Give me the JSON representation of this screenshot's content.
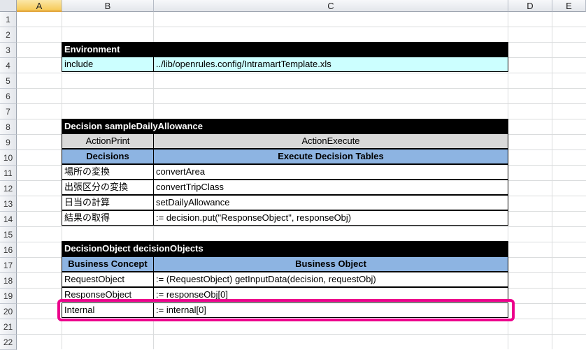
{
  "columns": [
    "A",
    "B",
    "C",
    "D",
    "E"
  ],
  "rows": [
    "1",
    "2",
    "3",
    "4",
    "5",
    "6",
    "7",
    "8",
    "9",
    "10",
    "11",
    "12",
    "13",
    "14",
    "15",
    "16",
    "17",
    "18",
    "19",
    "20",
    "21",
    "22"
  ],
  "environment": {
    "title": "Environment",
    "key": "include",
    "value": "../lib/openrules.config/IntramartTemplate.xls"
  },
  "decision": {
    "title": "Decision sampleDailyAllowance",
    "header_b": "ActionPrint",
    "header_c": "ActionExecute",
    "sub_b": "Decisions",
    "sub_c": "Execute Decision Tables",
    "rows": [
      {
        "b": "場所の変換",
        "c": "convertArea"
      },
      {
        "b": "出張区分の変換",
        "c": "convertTripClass"
      },
      {
        "b": "日当の計算",
        "c": "setDailyAllowance"
      },
      {
        "b": "結果の取得",
        "c": ":= decision.put(\"ResponseObject\", responseObj)"
      }
    ]
  },
  "decision_objects": {
    "title": "DecisionObject decisionObjects",
    "header_b": "Business Concept",
    "header_c": "Business Object",
    "rows": [
      {
        "b": "RequestObject",
        "c": ":=  (RequestObject) getInputData(decision, requestObj)"
      },
      {
        "b": "ResponseObject",
        "c": ":=  responseObj[0]"
      },
      {
        "b": "Internal",
        "c": ":=  internal[0]"
      }
    ]
  },
  "highlight_color": "#ec008c"
}
